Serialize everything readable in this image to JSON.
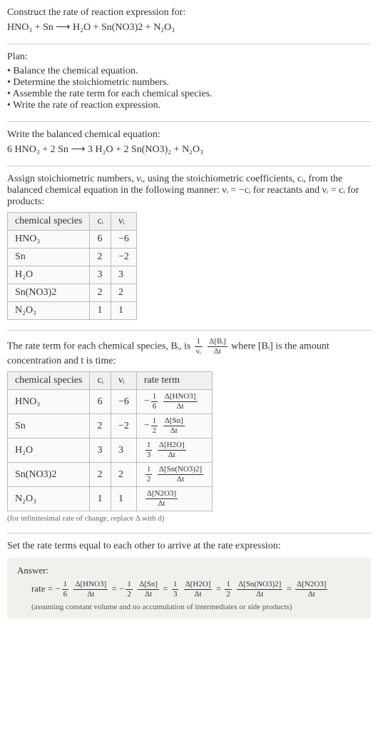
{
  "intro": {
    "line1": "Construct the rate of reaction expression for:",
    "eq": "HNO₃ + Sn ⟶ H₂O + Sn(NO3)2 + N₂O₃"
  },
  "plan": {
    "title": "Plan:",
    "items": [
      "Balance the chemical equation.",
      "Determine the stoichiometric numbers.",
      "Assemble the rate term for each chemical species.",
      "Write the rate of reaction expression."
    ]
  },
  "balanced": {
    "title": "Write the balanced chemical equation:",
    "eq": "6 HNO₃ + 2 Sn ⟶ 3 H₂O + 2 Sn(NO3)₂ + N₂O₃"
  },
  "stoich": {
    "intro_a": "Assign stoichiometric numbers, νᵢ, using the stoichiometric coefficients, cᵢ, from the balanced chemical equation in the following manner: νᵢ = −cᵢ for reactants and νᵢ = cᵢ for products:",
    "headers": [
      "chemical species",
      "cᵢ",
      "νᵢ"
    ],
    "rows": [
      {
        "sp": "HNO₃",
        "c": "6",
        "v": "−6"
      },
      {
        "sp": "Sn",
        "c": "2",
        "v": "−2"
      },
      {
        "sp": "H₂O",
        "c": "3",
        "v": "3"
      },
      {
        "sp": "Sn(NO3)2",
        "c": "2",
        "v": "2"
      },
      {
        "sp": "N₂O₃",
        "c": "1",
        "v": "1"
      }
    ]
  },
  "rateterm": {
    "intro_a": "The rate term for each chemical species, Bᵢ, is ",
    "intro_b": " where [Bᵢ] is the amount concentration and t is time:",
    "headers": [
      "chemical species",
      "cᵢ",
      "νᵢ",
      "rate term"
    ],
    "rows": [
      {
        "sp": "HNO₃",
        "c": "6",
        "v": "−6",
        "coef_num": "1",
        "coef_den": "6",
        "sign": "−",
        "d_top": "Δ[HNO3]",
        "d_bot": "Δt"
      },
      {
        "sp": "Sn",
        "c": "2",
        "v": "−2",
        "coef_num": "1",
        "coef_den": "2",
        "sign": "−",
        "d_top": "Δ[Sn]",
        "d_bot": "Δt"
      },
      {
        "sp": "H₂O",
        "c": "3",
        "v": "3",
        "coef_num": "1",
        "coef_den": "3",
        "sign": "",
        "d_top": "Δ[H2O]",
        "d_bot": "Δt"
      },
      {
        "sp": "Sn(NO3)2",
        "c": "2",
        "v": "2",
        "coef_num": "1",
        "coef_den": "2",
        "sign": "",
        "d_top": "Δ[Sn(NO3)2]",
        "d_bot": "Δt"
      },
      {
        "sp": "N₂O₃",
        "c": "1",
        "v": "1",
        "coef_num": "",
        "coef_den": "",
        "sign": "",
        "d_top": "Δ[N2O3]",
        "d_bot": "Δt"
      }
    ],
    "note": "(for infinitesimal rate of change, replace Δ with d)"
  },
  "final": {
    "title": "Set the rate terms equal to each other to arrive at the rate expression:"
  },
  "answer": {
    "title": "Answer:",
    "lead": "rate = ",
    "terms": [
      {
        "sign": "−",
        "cn": "1",
        "cd": "6",
        "top": "Δ[HNO3]",
        "bot": "Δt"
      },
      {
        "sign": "−",
        "cn": "1",
        "cd": "2",
        "top": "Δ[Sn]",
        "bot": "Δt"
      },
      {
        "sign": "",
        "cn": "1",
        "cd": "3",
        "top": "Δ[H2O]",
        "bot": "Δt"
      },
      {
        "sign": "",
        "cn": "1",
        "cd": "2",
        "top": "Δ[Sn(NO3)2]",
        "bot": "Δt"
      },
      {
        "sign": "",
        "cn": "",
        "cd": "",
        "top": "Δ[N2O3]",
        "bot": "Δt"
      }
    ],
    "note": "(assuming constant volume and no accumulation of intermediates or side products)"
  },
  "sym": {
    "one_over_nu_top": "1",
    "one_over_nu_bot": "νᵢ",
    "dBi_top": "Δ[Bᵢ]",
    "dBi_bot": "Δt"
  }
}
